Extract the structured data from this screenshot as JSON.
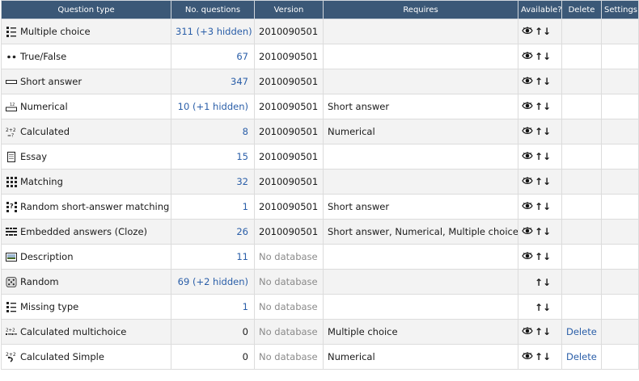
{
  "headers": {
    "question_type": "Question type",
    "no_questions": "No. questions",
    "version": "Version",
    "requires": "Requires",
    "available": "Available?",
    "delete": "Delete",
    "settings": "Settings"
  },
  "rows": [
    {
      "type": "Multiple choice",
      "icon": "multichoice-icon",
      "count": "311 (+3 hidden)",
      "version": "2010090501",
      "requires": "",
      "visible": true,
      "delete": ""
    },
    {
      "type": "True/False",
      "icon": "truefalse-icon",
      "count": "67",
      "version": "2010090501",
      "requires": "",
      "visible": true,
      "delete": ""
    },
    {
      "type": "Short answer",
      "icon": "shortanswer-icon",
      "count": "347",
      "version": "2010090501",
      "requires": "",
      "visible": true,
      "delete": ""
    },
    {
      "type": "Numerical",
      "icon": "numerical-icon",
      "count": "10 (+1 hidden)",
      "version": "2010090501",
      "requires": "Short answer",
      "visible": true,
      "delete": ""
    },
    {
      "type": "Calculated",
      "icon": "calculated-icon",
      "count": "8",
      "version": "2010090501",
      "requires": "Numerical",
      "visible": true,
      "delete": ""
    },
    {
      "type": "Essay",
      "icon": "essay-icon",
      "count": "15",
      "version": "2010090501",
      "requires": "",
      "visible": true,
      "delete": ""
    },
    {
      "type": "Matching",
      "icon": "matching-icon",
      "count": "32",
      "version": "2010090501",
      "requires": "",
      "visible": true,
      "delete": ""
    },
    {
      "type": "Random short-answer matching",
      "icon": "random-matching-icon",
      "count": "1",
      "version": "2010090501",
      "requires": "Short answer",
      "visible": true,
      "delete": ""
    },
    {
      "type": "Embedded answers (Cloze)",
      "icon": "cloze-icon",
      "count": "26",
      "version": "2010090501",
      "requires": "Short answer, Numerical, Multiple choice",
      "visible": true,
      "delete": ""
    },
    {
      "type": "Description",
      "icon": "description-icon",
      "count": "11",
      "version": "No database",
      "requires": "",
      "visible": true,
      "delete": ""
    },
    {
      "type": "Random",
      "icon": "dice-icon",
      "count": "69 (+2 hidden)",
      "version": "No database",
      "requires": "",
      "visible": false,
      "delete": ""
    },
    {
      "type": "Missing type",
      "icon": "missingtype-icon",
      "count": "1",
      "version": "No database",
      "requires": "",
      "visible": false,
      "delete": ""
    },
    {
      "type": "Calculated multichoice",
      "icon": "calculated-multichoice-icon",
      "count": "0",
      "version": "No database",
      "requires": "Multiple choice",
      "visible": true,
      "delete": "Delete"
    },
    {
      "type": "Calculated Simple",
      "icon": "calculated-simple-icon",
      "count": "0",
      "version": "No database",
      "requires": "Numerical",
      "visible": true,
      "delete": "Delete"
    }
  ],
  "colors": {
    "header_bg": "#3b5877",
    "link": "#2a5ea8",
    "muted": "#8a8a8a"
  }
}
